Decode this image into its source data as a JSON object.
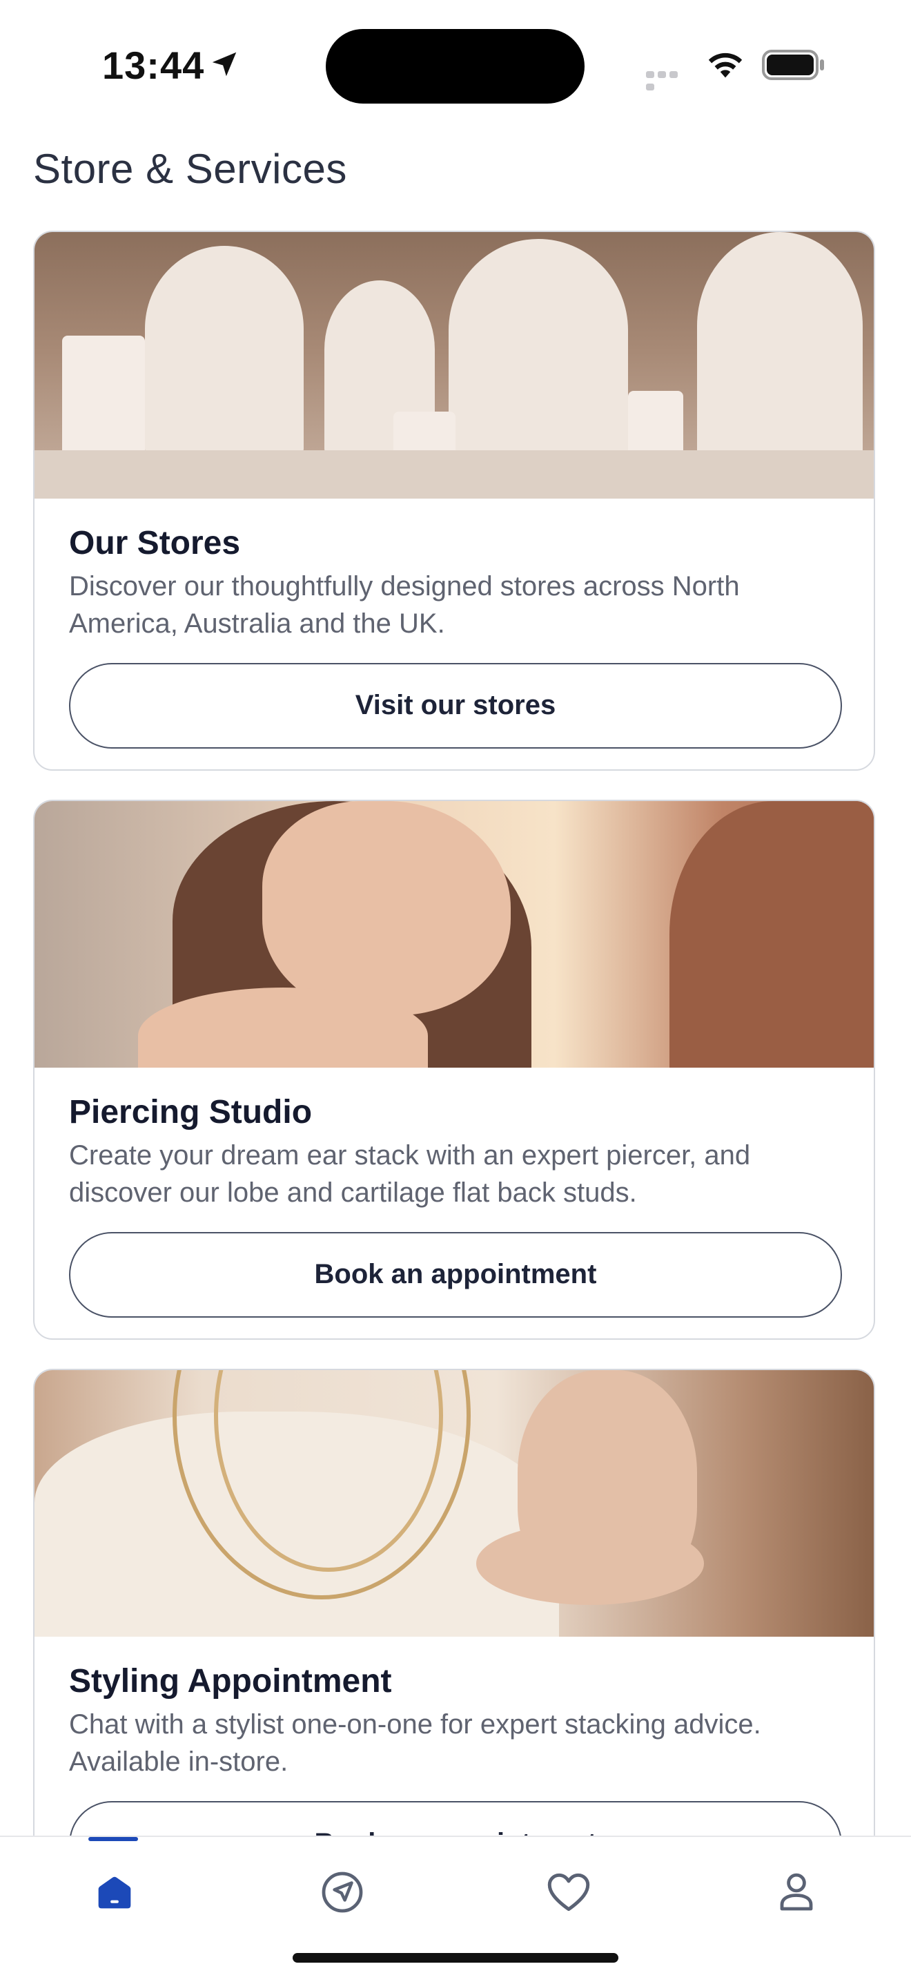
{
  "status_bar": {
    "time": "13:44"
  },
  "page": {
    "title": "Store & Services"
  },
  "cards": [
    {
      "title": "Our Stores",
      "description": "Discover our thoughtfully designed stores across North America, Australia and the UK.",
      "button": "Visit our stores"
    },
    {
      "title": "Piercing Studio",
      "description": "Create your dream ear stack with an expert piercer, and discover our lobe and cartilage flat back studs.",
      "button": "Book an appointment"
    },
    {
      "title": "Styling Appointment",
      "description": "Chat with a stylist one-on-one for expert stacking advice. Available in-store.",
      "button": "Book an appointment"
    }
  ],
  "bottom_nav": {
    "items": [
      {
        "icon": "home-icon",
        "active": true
      },
      {
        "icon": "compass-icon",
        "active": false
      },
      {
        "icon": "heart-icon",
        "active": false
      },
      {
        "icon": "profile-icon",
        "active": false
      }
    ],
    "active_color": "#1c49b8",
    "inactive_color": "#5a6274"
  }
}
